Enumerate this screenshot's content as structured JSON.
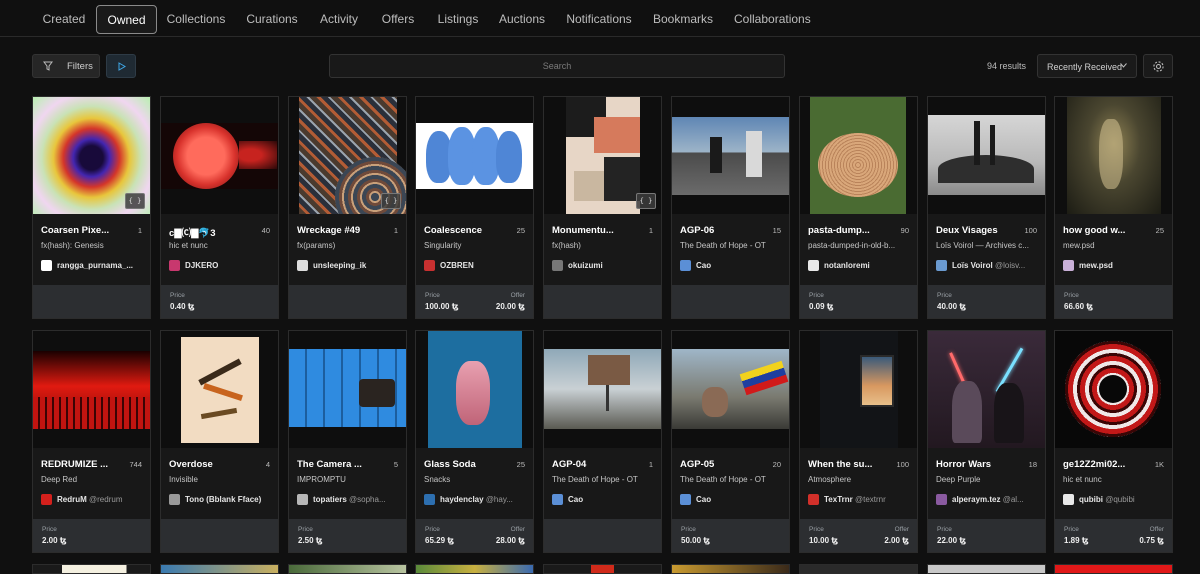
{
  "tabs": [
    "Created",
    "Owned",
    "Collections",
    "Curations",
    "Activity",
    "Offers",
    "Listings",
    "Auctions",
    "Notifications",
    "Bookmarks",
    "Collaborations"
  ],
  "active_tab": "Owned",
  "toolbar": {
    "filters_label": "Filters",
    "search_placeholder": "Search",
    "results": "94 results",
    "sort_label": "Recently Received"
  },
  "labels": {
    "price": "Price",
    "offer": "Offer"
  },
  "cards": [
    {
      "title": "Coarsen Pixe...",
      "edition": "1",
      "collection": "fx(hash): Genesis",
      "artist": "rangga_purnama_...",
      "handle": "",
      "price": "",
      "offer": "",
      "fx": "{ }"
    },
    {
      "title": "c▇⒞▇🐬3",
      "edition": "40",
      "collection": "hic et nunc",
      "artist": "DJKERO",
      "handle": "",
      "price": "0.40 ꜩ",
      "offer": "",
      "fx": ""
    },
    {
      "title": "Wreckage #49",
      "edition": "1",
      "collection": "fx(params)",
      "artist": "unsleeping_ik",
      "handle": "",
      "price": "",
      "offer": "",
      "fx": "{ }"
    },
    {
      "title": "Coalescence",
      "edition": "25",
      "collection": "Singularity",
      "artist": "OZBREN",
      "handle": "",
      "price": "100.00 ꜩ",
      "offer": "20.00 ꜩ",
      "fx": ""
    },
    {
      "title": "Monumentu...",
      "edition": "1",
      "collection": "fx(hash)",
      "artist": "okuizumi",
      "handle": "",
      "price": "",
      "offer": "",
      "fx": "{ }"
    },
    {
      "title": "AGP-06",
      "edition": "15",
      "collection": "The Death of Hope - OT",
      "artist": "Cao",
      "handle": "",
      "price": "",
      "offer": "",
      "fx": ""
    },
    {
      "title": "pasta-dump...",
      "edition": "90",
      "collection": "pasta-dumped-in-old-b...",
      "artist": "notanloremi",
      "handle": "",
      "price": "0.09 ꜩ",
      "offer": "",
      "fx": ""
    },
    {
      "title": "Deux Visages",
      "edition": "100",
      "collection": "Loïs Voirol — Archives c...",
      "artist": "Loïs Voirol",
      "handle": "@loisv...",
      "price": "40.00 ꜩ",
      "offer": "",
      "fx": ""
    },
    {
      "title": "how good w...",
      "edition": "25",
      "collection": "mew.psd",
      "artist": "mew.psd",
      "handle": "",
      "price": "66.60 ꜩ",
      "offer": "",
      "fx": ""
    },
    {
      "title": "REDRUMIZE ...",
      "edition": "744",
      "collection": "Deep Red",
      "artist": "RedruM",
      "handle": "@redrum",
      "price": "2.00 ꜩ",
      "offer": "",
      "fx": ""
    },
    {
      "title": "Overdose",
      "edition": "4",
      "collection": "Invisible",
      "artist": "Tono (Bblank Fface)",
      "handle": "",
      "price": "",
      "offer": "",
      "fx": ""
    },
    {
      "title": "The Camera ...",
      "edition": "5",
      "collection": "IMPROMPTU",
      "artist": "topatiers",
      "handle": "@sopha...",
      "price": "2.50 ꜩ",
      "offer": "",
      "fx": ""
    },
    {
      "title": "Glass Soda",
      "edition": "25",
      "collection": "Snacks",
      "artist": "haydenclay",
      "handle": "@hay...",
      "price": "65.29 ꜩ",
      "offer": "28.00 ꜩ",
      "fx": ""
    },
    {
      "title": "AGP-04",
      "edition": "1",
      "collection": "The Death of Hope - OT",
      "artist": "Cao",
      "handle": "",
      "price": "",
      "offer": "",
      "fx": ""
    },
    {
      "title": "AGP-05",
      "edition": "20",
      "collection": "The Death of Hope - OT",
      "artist": "Cao",
      "handle": "",
      "price": "50.00 ꜩ",
      "offer": "",
      "fx": ""
    },
    {
      "title": "When the su...",
      "edition": "100",
      "collection": "Atmosphere",
      "artist": "TexTrnr",
      "handle": "@textrnr",
      "price": "10.00 ꜩ",
      "offer": "2.00 ꜩ",
      "fx": ""
    },
    {
      "title": "Horror Wars",
      "edition": "18",
      "collection": "Deep Purple",
      "artist": "alperaym.tez",
      "handle": "@al...",
      "price": "22.00 ꜩ",
      "offer": "",
      "fx": ""
    },
    {
      "title": "ge12Z2mi02...",
      "edition": "1K",
      "collection": "hic et nunc",
      "artist": "qubibi",
      "handle": "@qubibi",
      "price": "1.89 ꜩ",
      "offer": "0.75 ꜩ",
      "fx": ""
    }
  ]
}
